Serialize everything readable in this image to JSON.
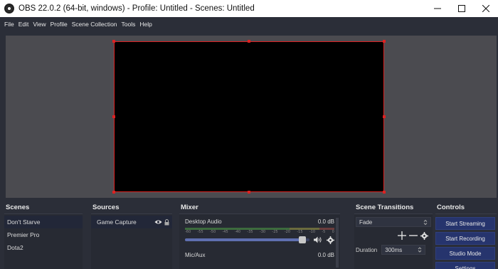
{
  "window": {
    "title": "OBS 22.0.2 (64-bit, windows) - Profile: Untitled - Scenes: Untitled",
    "minimize_icon": "minimize-icon",
    "maximize_icon": "maximize-icon",
    "close_icon": "close-icon"
  },
  "menu": {
    "items": [
      "File",
      "Edit",
      "View",
      "Profile",
      "Scene Collection",
      "Tools",
      "Help"
    ]
  },
  "scenes": {
    "title": "Scenes",
    "items": [
      "Don't Starve",
      "Premier Pro",
      "Dota2"
    ]
  },
  "sources": {
    "title": "Sources",
    "items": [
      {
        "name": "Game Capture",
        "visibility_icon": "eye-icon",
        "lock_icon": "lock-icon"
      }
    ]
  },
  "mixer": {
    "title": "Mixer",
    "channels": [
      {
        "name": "Desktop Audio",
        "level": "0.0 dB",
        "volume_fraction": 0.97
      },
      {
        "name": "Mic/Aux",
        "level": "0.0 dB"
      }
    ],
    "meter_ticks": [
      "-60",
      "-55",
      "-50",
      "-45",
      "-40",
      "-35",
      "-30",
      "-25",
      "-20",
      "-15",
      "-10",
      "-5",
      "0"
    ]
  },
  "transitions": {
    "title": "Scene Transitions",
    "selected": "Fade",
    "duration_label": "Duration",
    "duration_value": "300ms"
  },
  "controls": {
    "title": "Controls",
    "start_streaming": "Start Streaming",
    "start_recording": "Start Recording",
    "studio_mode": "Studio Mode",
    "settings": "Settings"
  },
  "colors": {
    "background": "#2b2e38",
    "preview_bg": "#4b4b50",
    "selection_border": "#dd2222",
    "button_blue": "#26346d"
  }
}
